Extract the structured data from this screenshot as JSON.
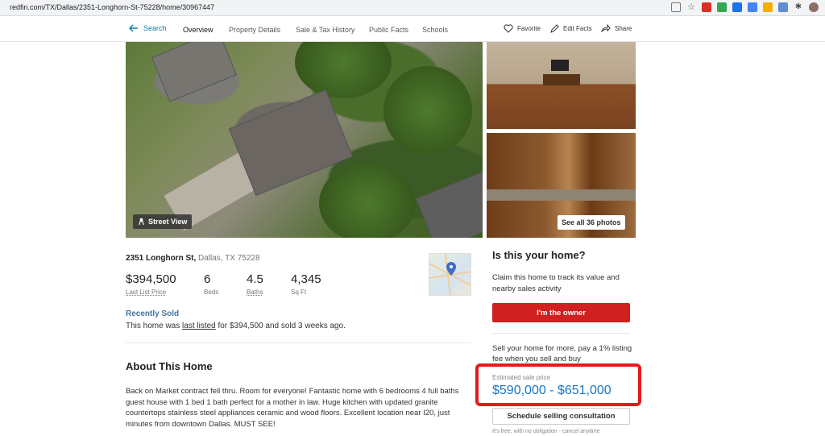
{
  "browser": {
    "url": "redfin.com/TX/Dallas/2351-Longhorn-St-75228/home/30967447"
  },
  "nav": {
    "back_label": "Search",
    "links": [
      "Overview",
      "Property Details",
      "Sale & Tax History",
      "Public Facts",
      "Schools"
    ],
    "actions": {
      "favorite": "Favorite",
      "edit": "Edit Facts",
      "share": "Share"
    }
  },
  "photos": {
    "street_view": "Street View",
    "see_all": "See all 36 photos"
  },
  "listing": {
    "street": "2351 Longhorn St,",
    "city": "Dallas, TX 75228",
    "price": "$394,500",
    "price_label": "Last List Price",
    "beds": "6",
    "beds_label": "Beds",
    "baths": "4.5",
    "baths_label": "Baths",
    "sqft": "4,345",
    "sqft_label": "Sq Ft",
    "status": "Recently Sold",
    "sold_pre": "This home was ",
    "sold_link": "last listed",
    "sold_post": " for $394,500 and sold 3 weeks ago."
  },
  "about": {
    "title": "About This Home",
    "text": "Back on Market contract fell thru. Room for everyone! Fantastic home with 6 bedrooms 4 full baths guest house with 1 bed 1 bath perfect for a mother in law. Huge kitchen with updated granite countertops stainless steel appliances ceramic and wood floors. Excellent location near I20, just minutes from downtown Dallas. MUST SEE!"
  },
  "owner_panel": {
    "title": "Is this your home?",
    "desc": "Claim this home to track its value and nearby sales activity",
    "owner_button": "I'm the owner",
    "sell_text": "Sell your home for more, pay a 1% listing fee when you sell and buy",
    "est_label": "Estimated sale price",
    "est_value": "$590,000 - $651,000",
    "schedule_button": "Schedule selling consultation",
    "free_note": "It's free, with no obligation - cancel anytime"
  },
  "colors": {
    "accent": "#0c82a5",
    "owner_button": "#d0201f",
    "highlight": "#e31b1b",
    "estimate": "#1a75c2"
  }
}
